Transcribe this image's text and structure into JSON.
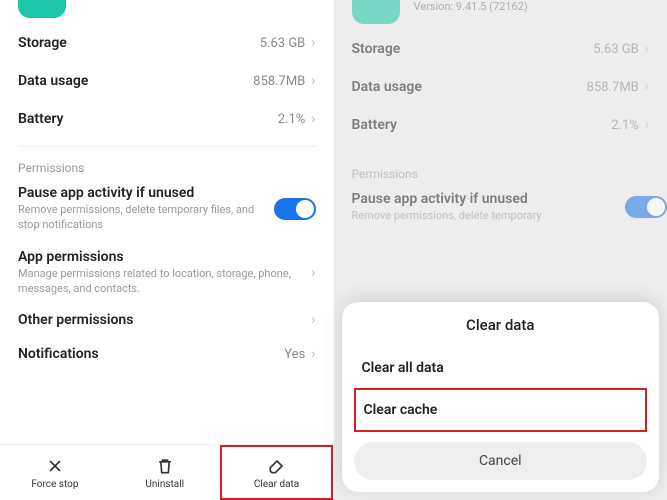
{
  "left": {
    "rows": {
      "storage": {
        "label": "Storage",
        "value": "5.63 GB"
      },
      "data_usage": {
        "label": "Data usage",
        "value": "858.7MB"
      },
      "battery": {
        "label": "Battery",
        "value": "2.1%"
      }
    },
    "permissions_title": "Permissions",
    "pause": {
      "title": "Pause app activity if unused",
      "sub": "Remove permissions, delete temporary files, and stop notifications"
    },
    "app_perm": {
      "title": "App permissions",
      "sub": "Manage permissions related to location, storage, phone, messages, and contacts."
    },
    "other_perm": {
      "title": "Other permissions"
    },
    "notifications": {
      "title": "Notifications",
      "value": "Yes"
    },
    "bottom": {
      "force_stop": "Force stop",
      "uninstall": "Uninstall",
      "clear_data": "Clear data"
    }
  },
  "right": {
    "version": "Version: 9.41.5 (72162)",
    "rows": {
      "storage": {
        "label": "Storage",
        "value": "5.63 GB"
      },
      "data_usage": {
        "label": "Data usage",
        "value": "858.7MB"
      },
      "battery": {
        "label": "Battery",
        "value": "2.1%"
      }
    },
    "permissions_title": "Permissions",
    "pause": {
      "title": "Pause app activity if unused",
      "sub": "Remove permissions, delete temporary"
    },
    "sheet": {
      "title": "Clear data",
      "clear_all": "Clear all data",
      "clear_cache": "Clear cache",
      "cancel": "Cancel"
    }
  }
}
